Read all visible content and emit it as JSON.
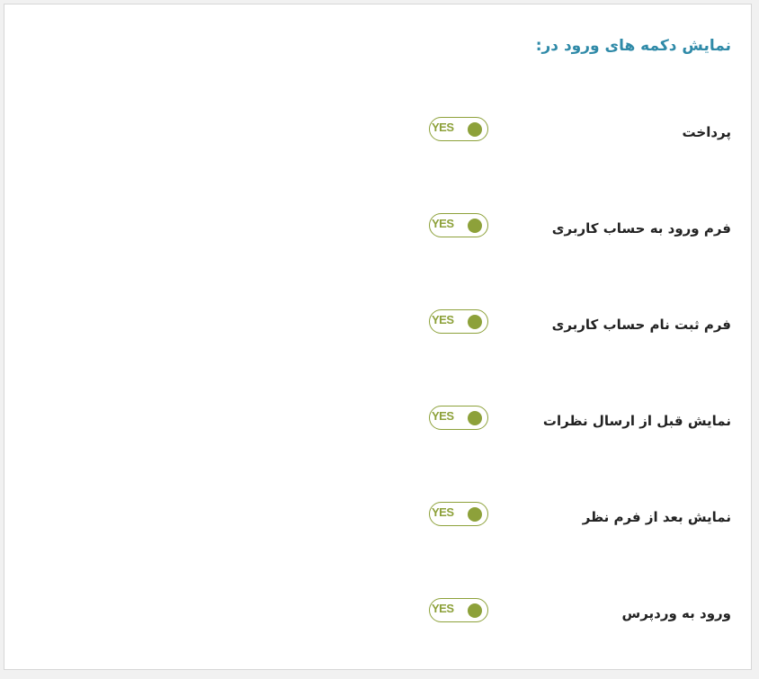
{
  "section": {
    "title": "نمایش دکمه های ورود در:"
  },
  "colors": {
    "title": "#2f8aa8",
    "toggle_accent": "#8da13a"
  },
  "settings": [
    {
      "label": "پرداخت",
      "toggle_text": "YES",
      "enabled": true
    },
    {
      "label": "فرم ورود به حساب کاربری",
      "toggle_text": "YES",
      "enabled": true
    },
    {
      "label": "فرم ثبت نام حساب کاربری",
      "toggle_text": "YES",
      "enabled": true
    },
    {
      "label": "نمایش قبل از ارسال نظرات",
      "toggle_text": "YES",
      "enabled": true
    },
    {
      "label": "نمایش بعد از فرم نظر",
      "toggle_text": "YES",
      "enabled": true
    },
    {
      "label": "ورود به وردپرس",
      "toggle_text": "YES",
      "enabled": true
    }
  ]
}
